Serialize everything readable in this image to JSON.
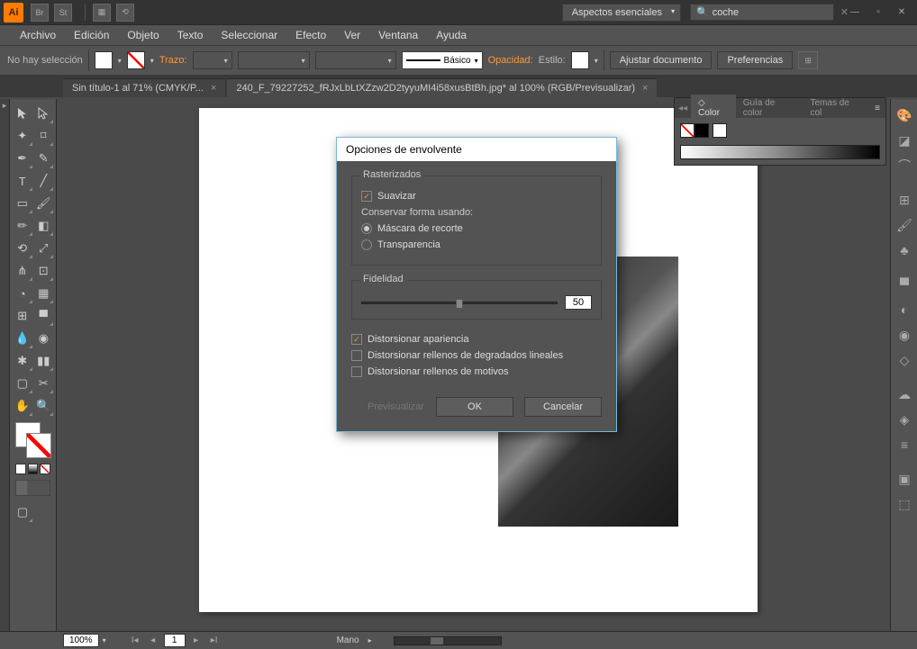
{
  "titlebar": {
    "app_abbrev": "Ai",
    "bridge_abbrev": "Br",
    "stock_abbrev": "St",
    "workspace": "Aspectos esenciales",
    "search_value": "coche"
  },
  "menu": {
    "file": "Archivo",
    "edit": "Edición",
    "object": "Objeto",
    "type": "Texto",
    "select": "Seleccionar",
    "effect": "Efecto",
    "view": "Ver",
    "window": "Ventana",
    "help": "Ayuda"
  },
  "control": {
    "no_selection": "No hay selección",
    "stroke": "Trazo:",
    "stroke_style_label": "Básico",
    "opacity": "Opacidad:",
    "style": "Estilo:",
    "fit_doc": "Ajustar documento",
    "prefs": "Preferencias"
  },
  "tabs": {
    "tab1": "Sin título-1 al 71% (CMYK/P...",
    "tab2": "240_F_79227252_fRJxLbLtXZzw2D2tyyuMI4i58xusBtBh.jpg* al 100% (RGB/Previsualizar)"
  },
  "color_panel": {
    "tab_color": "Color",
    "tab_guide": "Guía de color",
    "tab_themes": "Temas de col"
  },
  "dialog": {
    "title": "Opciones de envolvente",
    "group_raster": "Rasterizados",
    "antialias": "Suavizar",
    "preserve_shape": "Conservar forma usando:",
    "clip_mask": "Máscara de recorte",
    "transparency": "Transparencia",
    "group_fidelity": "Fidelidad",
    "fidelity_value": "50",
    "distort_appearance": "Distorsionar apariencia",
    "distort_linear": "Distorsionar rellenos de degradados lineales",
    "distort_pattern": "Distorsionar rellenos de motivos",
    "preview": "Previsualizar",
    "ok": "OK",
    "cancel": "Cancelar"
  },
  "status": {
    "zoom": "100%",
    "page": "1",
    "tool": "Mano"
  }
}
